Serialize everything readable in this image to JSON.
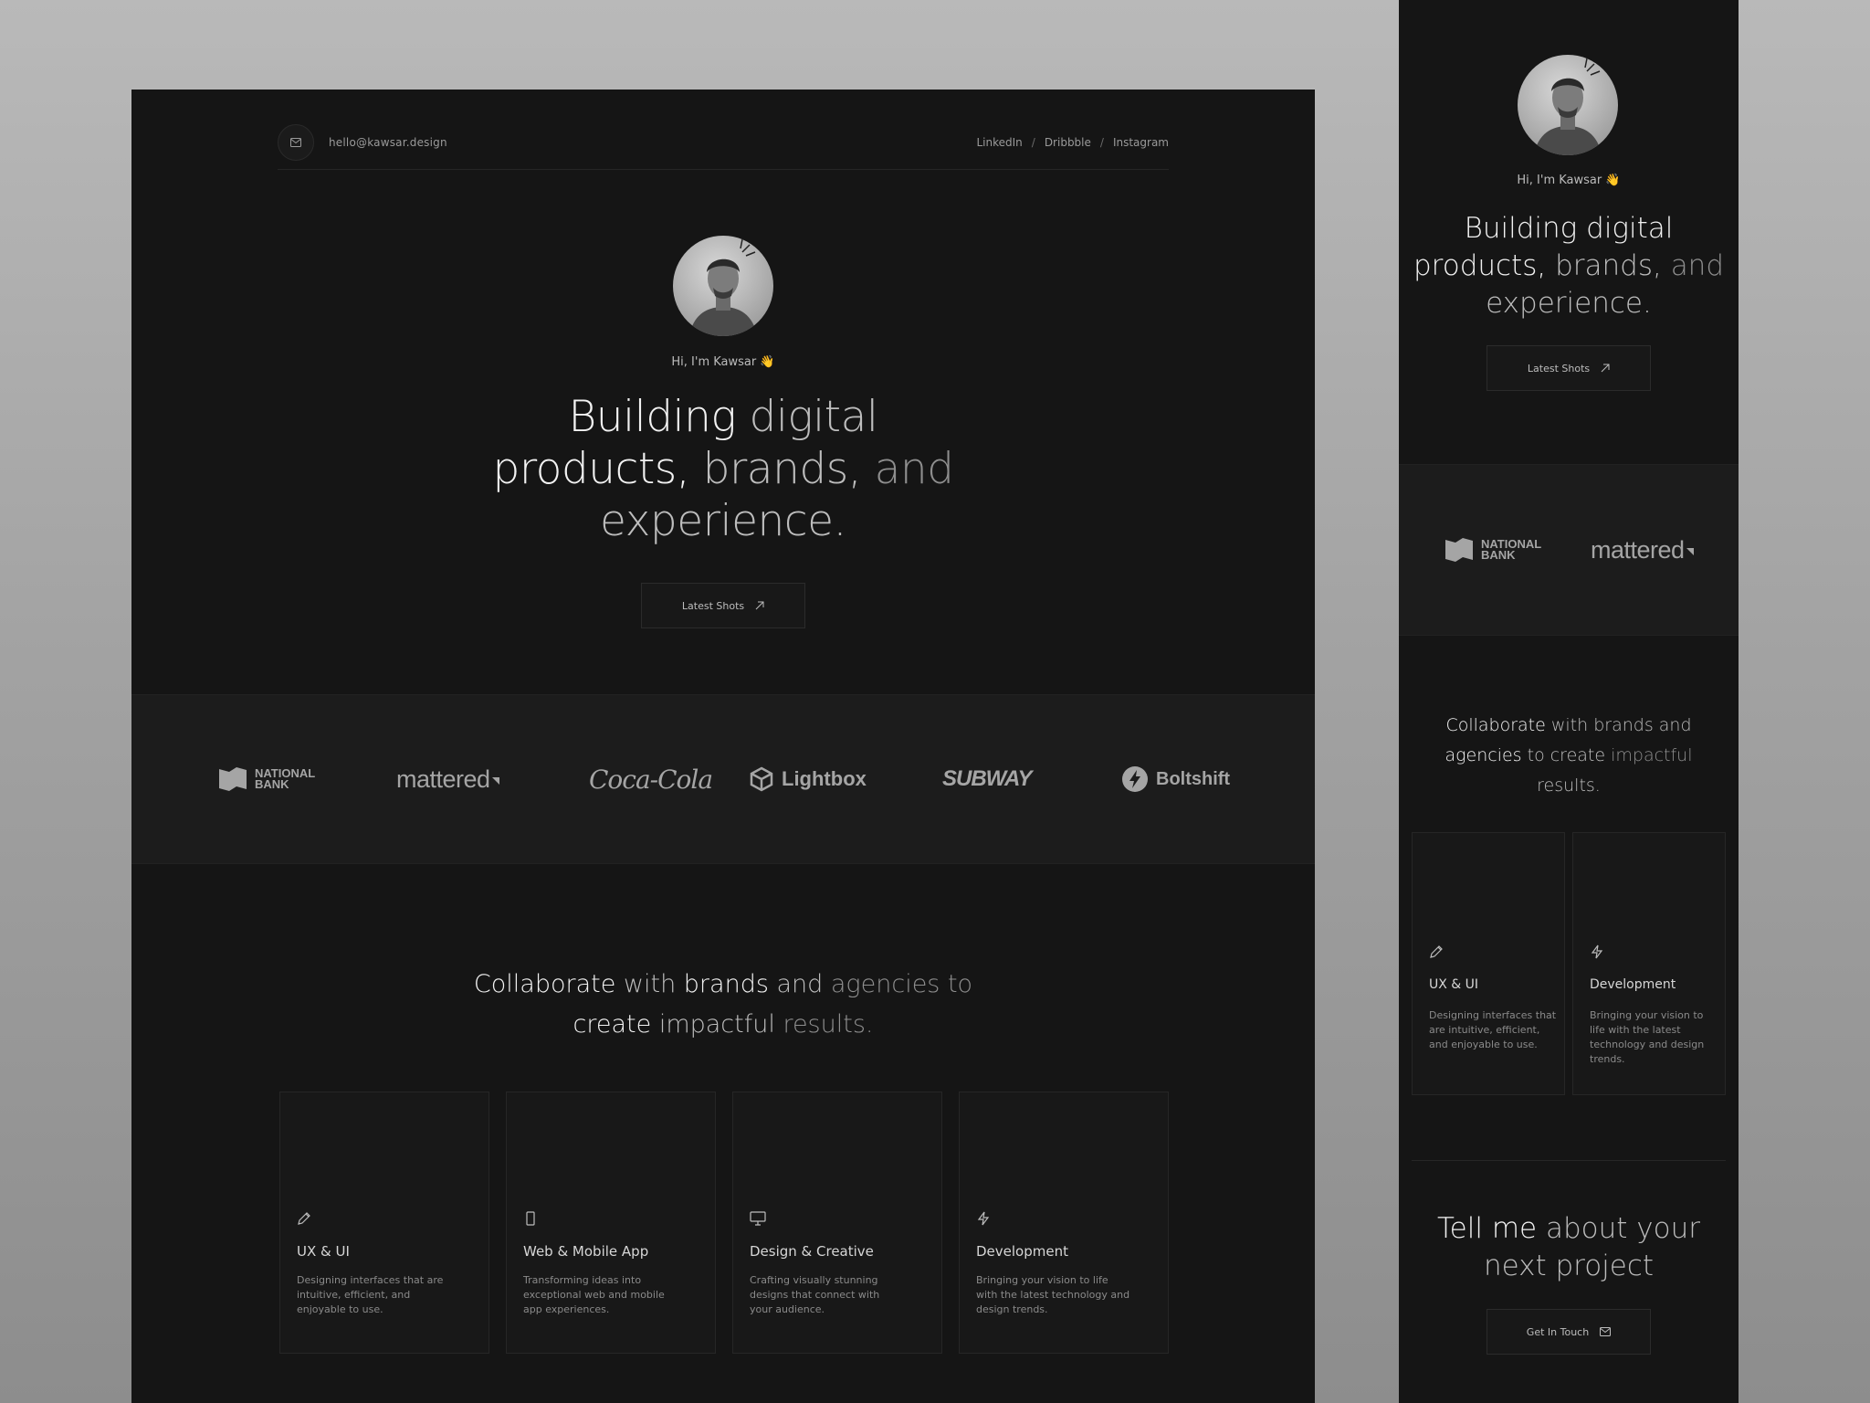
{
  "desktop": {
    "email": "hello@kawsar.design",
    "socials": [
      "LinkedIn",
      "Dribbble",
      "Instagram"
    ],
    "separator": "/",
    "greeting": "Hi, I'm Kawsar",
    "wave": "👋",
    "headline": {
      "line1a": "Building ",
      "line1b": "digital",
      "line2a": "products, ",
      "line2b": "brands, ",
      "line2c": "and",
      "line3": "experience."
    },
    "cta_label": "Latest Shots",
    "logos": {
      "national_top": "NATIONAL",
      "national_bottom": "BANK",
      "mattered": "mattered",
      "cocacola": "Coca-Cola",
      "lightbox": "Lightbox",
      "subway": "SUBWAY",
      "boltshift": "Boltshift"
    },
    "collab": {
      "p1": "Collaborate",
      "p2": " with ",
      "p3": "brands",
      "p4": " and ",
      "p5": "agencies to",
      "p6": "create ",
      "p7": "impactful",
      "p8": " results."
    },
    "services": [
      {
        "icon": "pencil-icon",
        "title": "UX & UI",
        "desc": "Designing interfaces that are intuitive, efficient, and enjoyable to use."
      },
      {
        "icon": "mobile-icon",
        "title": "Web & Mobile App",
        "desc": "Transforming ideas into exceptional web and mobile app experiences."
      },
      {
        "icon": "monitor-icon",
        "title": "Design & Creative",
        "desc": "Crafting visually stunning designs that connect with your audience."
      },
      {
        "icon": "bolt-icon",
        "title": "Development",
        "desc": "Bringing your vision to life with the latest technology and design trends."
      }
    ]
  },
  "mobile": {
    "greeting": "Hi, I'm Kawsar",
    "wave": "👋",
    "headline": {
      "line1a": "Building ",
      "line1b": "digital",
      "line2a": "products, ",
      "line2b": "brands, ",
      "line2c": "and",
      "line3": "experience."
    },
    "cta_label": "Latest Shots",
    "logos": {
      "national_top": "NATIONAL",
      "national_bottom": "BANK",
      "mattered": "mattered"
    },
    "collab": {
      "p1": "Collaborate",
      "p2": " with ",
      "p3": "brands and",
      "p4": "agencies",
      "p5": " to ",
      "p6": "create ",
      "p7": "impactful",
      "p8": "results."
    },
    "services": [
      {
        "icon": "pencil-icon",
        "title": "UX & UI",
        "desc": "Designing interfaces that are intuitive, efficient, and enjoyable to use."
      },
      {
        "icon": "bolt-icon",
        "title": "Development",
        "desc": "Bringing your vision to life with the latest technology and design trends."
      }
    ],
    "tell": {
      "l1a": "Tell me ",
      "l1b": "about your",
      "l2a": "next ",
      "l2b": "project"
    },
    "contact_label": "Get In Touch"
  },
  "colors": {
    "background": "#151515",
    "band": "#1c1c1c",
    "accent_wave": "#f2c14e"
  }
}
